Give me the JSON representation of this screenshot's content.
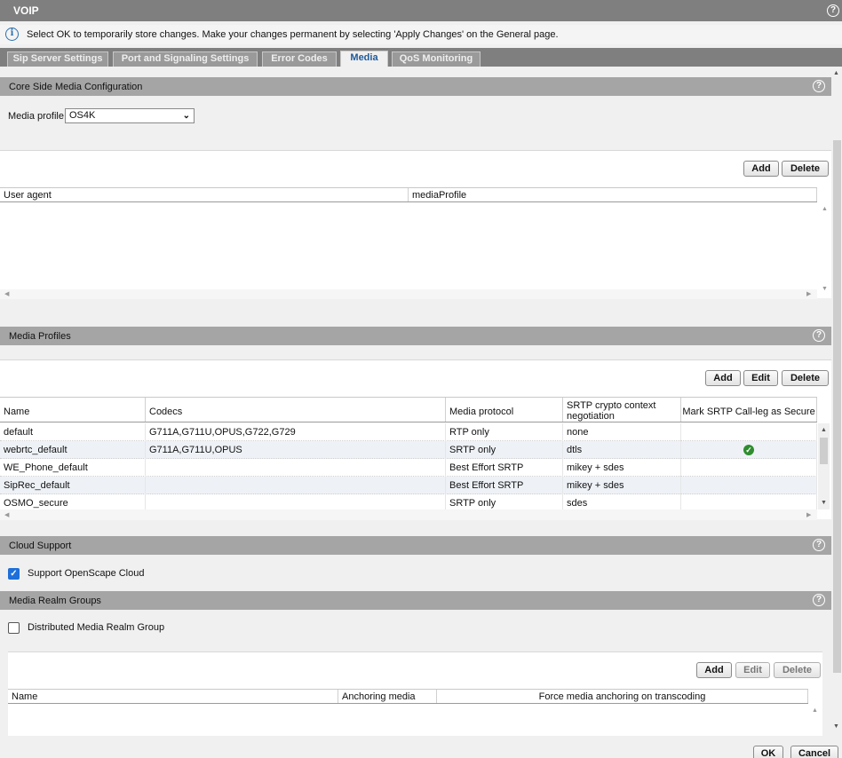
{
  "app": {
    "title": "VOIP"
  },
  "info": {
    "message": "Select OK to temporarily store changes. Make your changes permanent by selecting 'Apply Changes' on the General page."
  },
  "tabs": [
    {
      "label": "Sip Server Settings"
    },
    {
      "label": "Port and Signaling Settings"
    },
    {
      "label": "Error Codes"
    },
    {
      "label": "Media",
      "active": true
    },
    {
      "label": "QoS Monitoring"
    }
  ],
  "core_media": {
    "section_title": "Core Side Media Configuration",
    "media_profile_label": "Media profile",
    "media_profile_value": "OS4K",
    "add_label": "Add",
    "delete_label": "Delete",
    "columns": [
      "User agent",
      "mediaProfile"
    ]
  },
  "media_profiles": {
    "section_title": "Media Profiles",
    "add_label": "Add",
    "edit_label": "Edit",
    "delete_label": "Delete",
    "columns": [
      "Name",
      "Codecs",
      "Media protocol",
      "SRTP crypto context negotiation",
      "Mark SRTP Call-leg as Secure"
    ],
    "rows": [
      {
        "name": "default",
        "codecs": "G711A,G711U,OPUS,G722,G729",
        "protocol": "RTP only",
        "srtp": "none",
        "secure": false
      },
      {
        "name": "webrtc_default",
        "codecs": "G711A,G711U,OPUS",
        "protocol": "SRTP only",
        "srtp": "dtls",
        "secure": true
      },
      {
        "name": "WE_Phone_default",
        "codecs": "",
        "protocol": "Best Effort SRTP",
        "srtp": "mikey + sdes",
        "secure": false
      },
      {
        "name": "SipRec_default",
        "codecs": "",
        "protocol": "Best Effort SRTP",
        "srtp": "mikey + sdes",
        "secure": false
      },
      {
        "name": "OSMO_secure",
        "codecs": "",
        "protocol": "SRTP only",
        "srtp": "sdes",
        "secure": false
      }
    ]
  },
  "cloud": {
    "section_title": "Cloud Support",
    "support_label": "Support OpenScape Cloud",
    "support_checked": true
  },
  "realm": {
    "section_title": "Media Realm Groups",
    "distributed_label": "Distributed Media Realm Group",
    "distributed_checked": false,
    "add_label": "Add",
    "edit_label": "Edit",
    "delete_label": "Delete",
    "columns": [
      "Name",
      "Anchoring media",
      "Force media anchoring on transcoding"
    ]
  },
  "footer": {
    "ok_label": "OK",
    "cancel_label": "Cancel"
  },
  "colors": {
    "accent": "#1f5a98",
    "header_gray": "#7f7f7f",
    "section_gray": "#a5a5a5",
    "ok_green": "#2f8d2f",
    "checkbox_blue": "#1e6fd9"
  }
}
